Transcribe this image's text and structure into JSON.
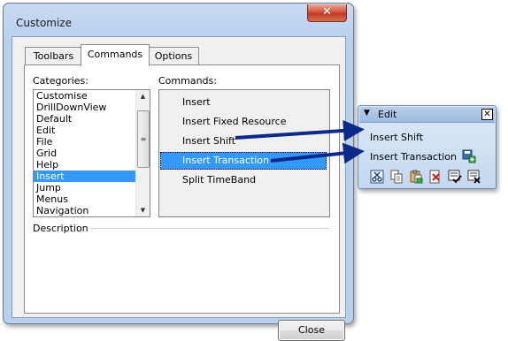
{
  "dialog": {
    "title": "Customize",
    "close_glyph": "✕",
    "tabs": [
      "Toolbars",
      "Commands",
      "Options"
    ],
    "active_tab": "Commands",
    "categories_label": "Categories:",
    "categories": [
      "Customise",
      "DrillDownView",
      "Default",
      "Edit",
      "File",
      "Grid",
      "Help",
      "Insert",
      "Jump",
      "Menus",
      "Navigation"
    ],
    "selected_category": "Insert",
    "commands_label": "Commands:",
    "commands": [
      "Insert",
      "Insert Fixed Resource",
      "Insert Shift",
      "Insert Transaction",
      "Split TimeBand"
    ],
    "selected_command": "Insert Transaction",
    "description_label": "Description",
    "close_button": "Close"
  },
  "edit_toolbar": {
    "title": "Edit",
    "dropdown_glyph": "▼",
    "close_glyph": "✕",
    "items": [
      "Insert Shift",
      "Insert Transaction"
    ],
    "icons": [
      "cut-icon",
      "copy-icon",
      "paste-icon",
      "delete-icon",
      "check-in-icon",
      "check-out-icon"
    ]
  },
  "colors": {
    "selection": "#3399ff",
    "arrow": "#0a2a8a",
    "dialog_frame": "#b9d1ee"
  }
}
